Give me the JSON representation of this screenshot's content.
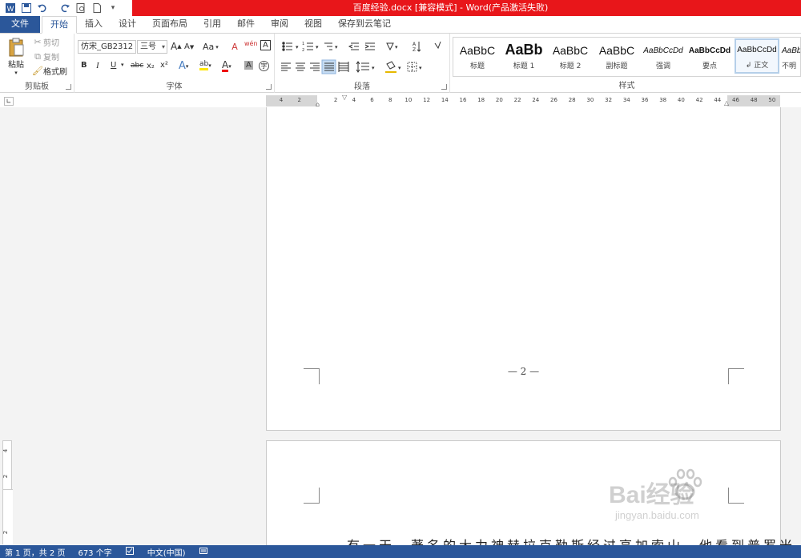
{
  "titlebar": {
    "title": "百度经验.docx [兼容模式] - Word(产品激活失败)"
  },
  "tabs": [
    {
      "label": "文件",
      "id": "file"
    },
    {
      "label": "开始",
      "id": "home"
    },
    {
      "label": "插入",
      "id": "insert"
    },
    {
      "label": "设计",
      "id": "design"
    },
    {
      "label": "页面布局",
      "id": "layout"
    },
    {
      "label": "引用",
      "id": "references"
    },
    {
      "label": "邮件",
      "id": "mailings"
    },
    {
      "label": "审阅",
      "id": "review"
    },
    {
      "label": "视图",
      "id": "view"
    },
    {
      "label": "保存到云笔记",
      "id": "cloud"
    }
  ],
  "clipboard": {
    "paste": "粘贴",
    "cut": "剪切",
    "copy": "复制",
    "format_painter": "格式刷",
    "group_label": "剪贴板"
  },
  "font": {
    "font_name": "仿宋_GB2312",
    "font_size": "三号",
    "grow": "A",
    "shrink": "A",
    "change_case": "Aa",
    "bold": "B",
    "italic": "I",
    "underline": "U",
    "strike": "abc",
    "subscript": "x₂",
    "superscript": "x²",
    "group_label": "字体"
  },
  "paragraph": {
    "group_label": "段落"
  },
  "styles": {
    "group_label": "样式",
    "items": [
      {
        "sample": "AaBbC",
        "name": "标题"
      },
      {
        "sample": "AaBb",
        "name": "标题 1"
      },
      {
        "sample": "AaBbC",
        "name": "标题 2"
      },
      {
        "sample": "AaBbC",
        "name": "副标题"
      },
      {
        "sample": "AaBbCcDd",
        "name": "强调"
      },
      {
        "sample": "AaBbCcDd",
        "name": "要点"
      },
      {
        "sample": "AaBbCcDd",
        "name": "正文"
      },
      {
        "sample": "AaBb",
        "name": "不明"
      }
    ]
  },
  "ruler": {
    "ticks": [
      "4",
      "2",
      "",
      "2",
      "4",
      "6",
      "8",
      "10",
      "12",
      "14",
      "16",
      "18",
      "20",
      "22",
      "24",
      "26",
      "28",
      "30",
      "32",
      "34",
      "36",
      "38",
      "40",
      "42",
      "44",
      "46",
      "48",
      "50"
    ]
  },
  "document": {
    "page_number": "— 2 —",
    "body_text": "有一天，著名的大力神赫拉克勒斯经过高加索山，他看到普罗米"
  },
  "vruler": {
    "ticks": [
      "4",
      "2",
      "",
      "2"
    ]
  },
  "statusbar": {
    "page": "第 1 页，共 2 页",
    "words": "673 个字",
    "language": "中文(中国)"
  },
  "watermark": {
    "brand": "Bai经验",
    "url": "jingyan.baidu.com"
  },
  "colors": {
    "title_red": "#e8161a",
    "word_blue": "#2b579a"
  }
}
